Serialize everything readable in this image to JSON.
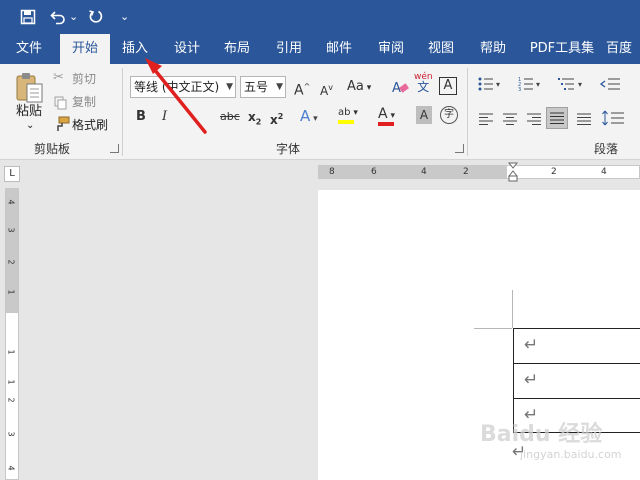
{
  "quick_access": {
    "save_icon": "save-icon",
    "undo_icon": "undo-icon",
    "undo_dropdown": "⌄",
    "redo_icon": "repeat-icon",
    "customize": "⌄"
  },
  "tabs": [
    {
      "label": "文件"
    },
    {
      "label": "开始"
    },
    {
      "label": "插入"
    },
    {
      "label": "设计"
    },
    {
      "label": "布局"
    },
    {
      "label": "引用"
    },
    {
      "label": "邮件"
    },
    {
      "label": "审阅"
    },
    {
      "label": "视图"
    },
    {
      "label": "帮助"
    },
    {
      "label": "PDF工具集"
    },
    {
      "label": "百度"
    }
  ],
  "active_tab": "开始",
  "clipboard": {
    "paste_label": "粘贴",
    "paste_dropdown": "⌄",
    "cut_label": "剪切",
    "copy_label": "复制",
    "format_painter_label": "格式刷",
    "group_label": "剪贴板"
  },
  "font": {
    "font_name": "等线 (中文正文)",
    "font_size": "五号",
    "group_label": "字体",
    "grow_font": "A",
    "shrink_font": "A",
    "change_case": "Aa",
    "bold": "B",
    "italic": "I",
    "strikethrough": "abc",
    "subscript": "x",
    "superscript": "x",
    "text_effects": "A",
    "highlight": "ab",
    "font_color": "A",
    "char_shading": "A",
    "enclose_char": "字",
    "phonetic": "wén",
    "phonetic_sub": "文",
    "char_border": "A"
  },
  "paragraph": {
    "group_label": "段落"
  },
  "ruler": {
    "h_numbers": [
      "8",
      "6",
      "4",
      "2",
      "2",
      "4"
    ],
    "v_numbers": [
      "4",
      "3",
      "2",
      "1",
      "1",
      "1",
      "2",
      "3",
      "4"
    ],
    "corner": "L"
  },
  "document": {
    "para_mark": "↵"
  },
  "watermark": {
    "text": "Baidu 经验",
    "url": "jingyan.baidu.com"
  },
  "colors": {
    "ribbon_blue": "#2b579a",
    "highlight_yellow": "#ffff00",
    "font_red": "#e02020",
    "arrow_red": "#e0201f"
  }
}
